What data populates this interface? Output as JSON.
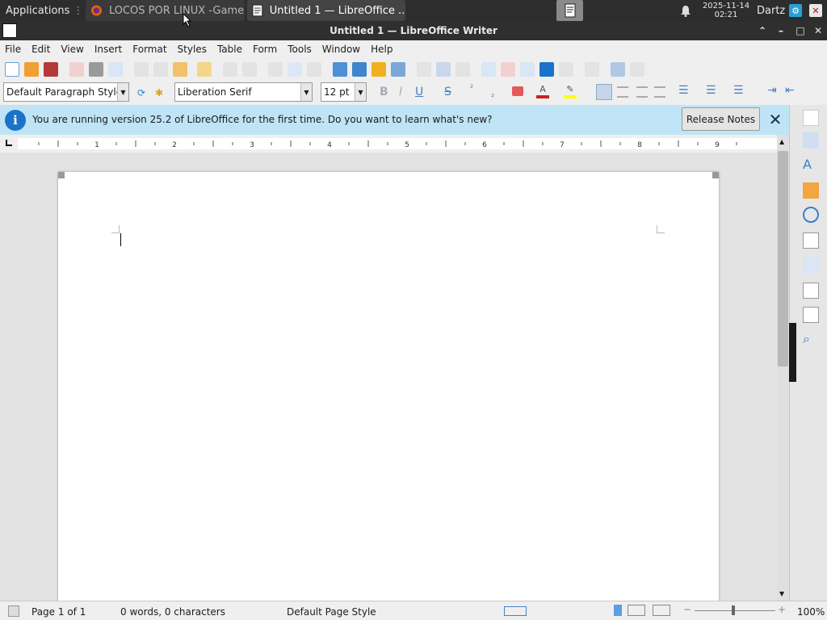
{
  "taskbar": {
    "apps_label": "Applications",
    "windows": [
      {
        "label": "LOCOS POR LINUX -Game..."
      },
      {
        "label": "Untitled 1 — LibreOffice ..."
      }
    ],
    "clock_date": "2025-11-14",
    "clock_time": "02:21",
    "user": "Dartz"
  },
  "window": {
    "title": "Untitled 1 — LibreOffice Writer"
  },
  "menubar": {
    "items": [
      "File",
      "Edit",
      "View",
      "Insert",
      "Format",
      "Styles",
      "Table",
      "Form",
      "Tools",
      "Window",
      "Help"
    ]
  },
  "formatting": {
    "paragraph_style": "Default Paragraph Style",
    "font_name": "Liberation Serif",
    "font_size": "12 pt"
  },
  "infobar": {
    "message": "You are running version 25.2 of LibreOffice for the first time. Do you want to learn what's new?",
    "button_label": "Release Notes"
  },
  "ruler": {
    "numbers": [
      "1",
      "2",
      "3",
      "4",
      "5",
      "6",
      "7",
      "8",
      "9"
    ]
  },
  "statusbar": {
    "page": "Page 1 of 1",
    "words": "0 words, 0 characters",
    "page_style": "Default Page Style",
    "zoom": "100%"
  },
  "colors": {
    "infobar_bg": "#bfe4f6",
    "info_icon": "#1a73c8",
    "font_color_swatch": "#c9211e",
    "highlight_swatch": "#ffff00"
  }
}
